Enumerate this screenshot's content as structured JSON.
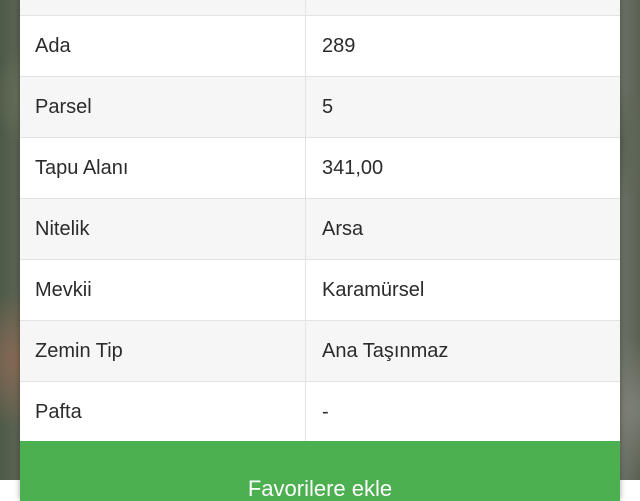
{
  "parcel_table": {
    "rows": [
      {
        "label": "",
        "value": ""
      },
      {
        "label": "Ada",
        "value": "289"
      },
      {
        "label": "Parsel",
        "value": "5"
      },
      {
        "label": "Tapu Alanı",
        "value": "341,00"
      },
      {
        "label": "Nitelik",
        "value": "Arsa"
      },
      {
        "label": "Mevkii",
        "value": "Karamürsel"
      },
      {
        "label": "Zemin Tip",
        "value": "Ana Taşınmaz"
      },
      {
        "label": "Pafta",
        "value": "-"
      }
    ]
  },
  "action": {
    "label": "Favorilere ekle"
  },
  "colors": {
    "button_green": "#4caf50",
    "row_alt": "#f6f6f6",
    "border": "#e3e3e3"
  }
}
